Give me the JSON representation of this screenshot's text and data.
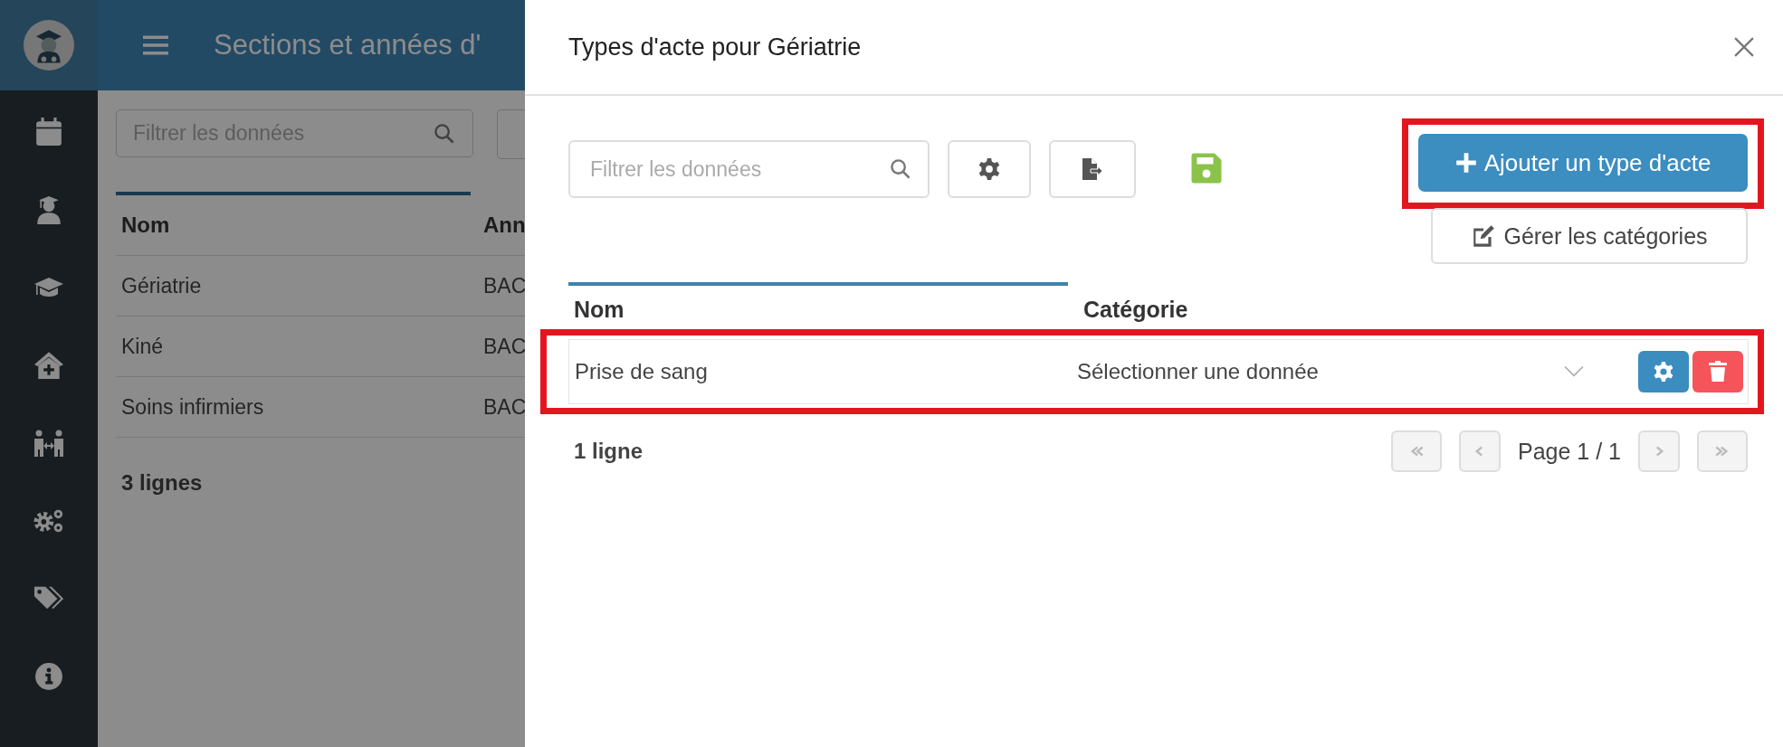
{
  "app": {
    "title": "Sections et années d'",
    "filter": {
      "placeholder": "Filtrer les données"
    },
    "table": {
      "columns": [
        "Nom",
        "Ann"
      ],
      "rows": [
        {
          "cells": [
            "Gériatrie",
            "BAC"
          ]
        },
        {
          "cells": [
            "Kiné",
            "BAC"
          ]
        },
        {
          "cells": [
            "Soins infirmiers",
            "BAC"
          ]
        }
      ]
    },
    "row_count": "3 lignes"
  },
  "modal": {
    "title": "Types d'acte pour Gériatrie",
    "filter": {
      "placeholder": "Filtrer les données"
    },
    "add_button": {
      "label": "Ajouter un type d'acte",
      "highlighted": true
    },
    "categories_button": {
      "label": "Gérer les catégories"
    },
    "table": {
      "columns": [
        "Nom",
        "Catégorie"
      ],
      "rows": [
        {
          "name": "Prise de sang",
          "category": {
            "placeholder": "Sélectionner une donnée"
          },
          "highlighted": true
        }
      ]
    },
    "row_count": "1 ligne",
    "pagination": {
      "label": "Page 1 / 1",
      "buttons": [
        {
          "kind": "first",
          "disabled": true
        },
        {
          "kind": "prev",
          "disabled": true
        },
        {
          "kind": "next",
          "disabled": true
        },
        {
          "kind": "last",
          "disabled": true
        }
      ]
    }
  }
}
